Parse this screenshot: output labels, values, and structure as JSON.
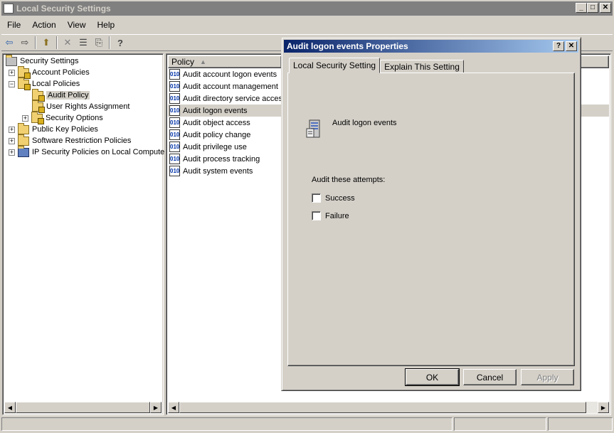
{
  "main_window": {
    "title": "Local Security Settings",
    "caption_buttons": {
      "minimize": "_",
      "maximize": "□",
      "close": "✕"
    }
  },
  "menu": [
    "File",
    "Action",
    "View",
    "Help"
  ],
  "toolbar": {
    "back": "⇦",
    "forward": "⇨",
    "up": "⬆",
    "delete": "✕",
    "properties": "☰",
    "export": "⎘",
    "help": "?"
  },
  "tree": {
    "items": [
      {
        "label": "Security Settings",
        "icon": "security-settings-icon"
      },
      {
        "label": "Account Policies",
        "icon": "folder-icon",
        "expander": "+"
      },
      {
        "label": "Local Policies",
        "icon": "folder-icon",
        "expander": "−"
      },
      {
        "label": "Audit Policy",
        "icon": "folder-icon"
      },
      {
        "label": "User Rights Assignment",
        "icon": "folder-icon"
      },
      {
        "label": "Security Options",
        "icon": "folder-icon",
        "expander": "+"
      },
      {
        "label": "Public Key Policies",
        "icon": "folder-icon",
        "expander": "+"
      },
      {
        "label": "Software Restriction Policies",
        "icon": "folder-icon",
        "expander": "+"
      },
      {
        "label": "IP Security Policies on Local Compute",
        "icon": "ip-security-icon",
        "expander": "+"
      }
    ]
  },
  "list": {
    "column_header": "Policy",
    "sort_indicator": "▲",
    "rows": [
      "Audit account logon events",
      "Audit account management",
      "Audit directory service access",
      "Audit logon events",
      "Audit object access",
      "Audit policy change",
      "Audit privilege use",
      "Audit process tracking",
      "Audit system events"
    ]
  },
  "dialog": {
    "title": "Audit logon events Properties",
    "help_button": "?",
    "close_button": "✕",
    "tabs": [
      "Local Security Setting",
      "Explain This Setting"
    ],
    "policy_name": "Audit logon events",
    "group_label": "Audit these attempts:",
    "checkboxes": [
      {
        "label": "Success",
        "checked": false
      },
      {
        "label": "Failure",
        "checked": false
      }
    ],
    "buttons": {
      "ok": "OK",
      "cancel": "Cancel",
      "apply": "Apply"
    }
  },
  "colors": {
    "active_title": "#0a246a",
    "inactive_title": "#808080",
    "face": "#d4d0c8"
  }
}
